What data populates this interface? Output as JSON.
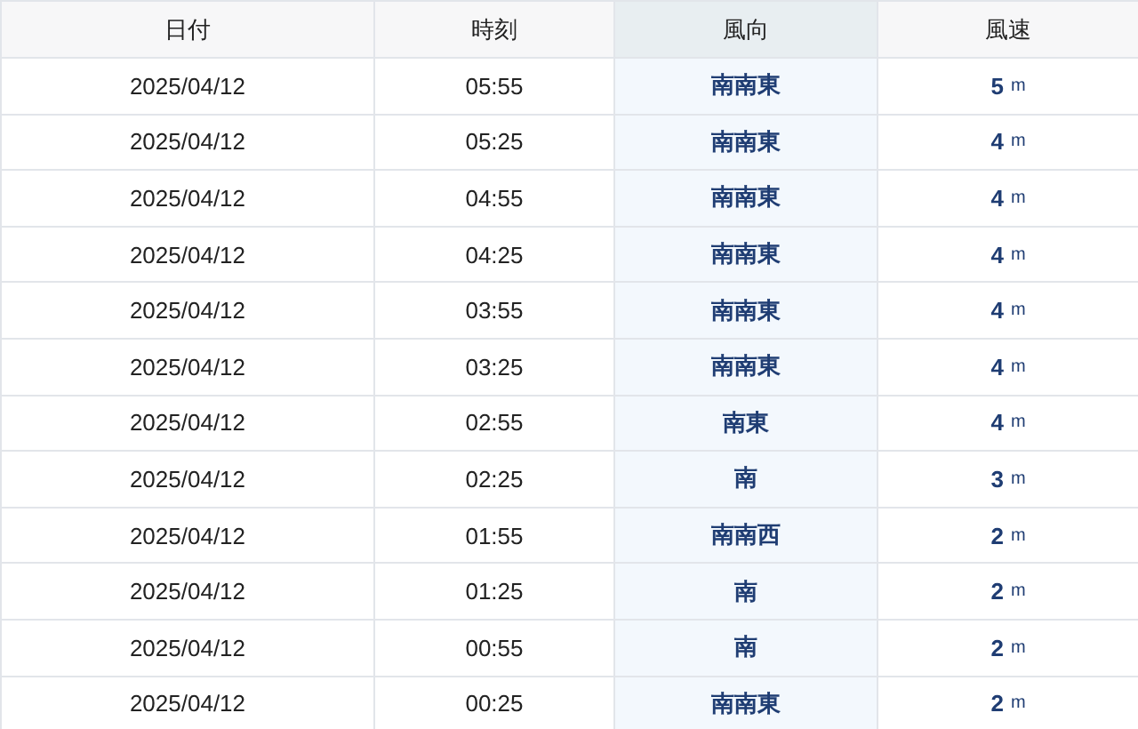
{
  "table": {
    "columns": [
      {
        "label": "日付",
        "selected": false
      },
      {
        "label": "時刻",
        "selected": false
      },
      {
        "label": "風向",
        "selected": true
      },
      {
        "label": "風速",
        "selected": false
      }
    ],
    "rows": [
      {
        "date": "2025/04/12",
        "time": "05:55",
        "direction": "南南東",
        "speed": "5",
        "unit": "m"
      },
      {
        "date": "2025/04/12",
        "time": "05:25",
        "direction": "南南東",
        "speed": "4",
        "unit": "m"
      },
      {
        "date": "2025/04/12",
        "time": "04:55",
        "direction": "南南東",
        "speed": "4",
        "unit": "m"
      },
      {
        "date": "2025/04/12",
        "time": "04:25",
        "direction": "南南東",
        "speed": "4",
        "unit": "m"
      },
      {
        "date": "2025/04/12",
        "time": "03:55",
        "direction": "南南東",
        "speed": "4",
        "unit": "m"
      },
      {
        "date": "2025/04/12",
        "time": "03:25",
        "direction": "南南東",
        "speed": "4",
        "unit": "m"
      },
      {
        "date": "2025/04/12",
        "time": "02:55",
        "direction": "南東",
        "speed": "4",
        "unit": "m"
      },
      {
        "date": "2025/04/12",
        "time": "02:25",
        "direction": "南",
        "speed": "3",
        "unit": "m"
      },
      {
        "date": "2025/04/12",
        "time": "01:55",
        "direction": "南南西",
        "speed": "2",
        "unit": "m"
      },
      {
        "date": "2025/04/12",
        "time": "01:25",
        "direction": "南",
        "speed": "2",
        "unit": "m"
      },
      {
        "date": "2025/04/12",
        "time": "00:55",
        "direction": "南",
        "speed": "2",
        "unit": "m"
      },
      {
        "date": "2025/04/12",
        "time": "00:25",
        "direction": "南南東",
        "speed": "2",
        "unit": "m"
      }
    ]
  }
}
